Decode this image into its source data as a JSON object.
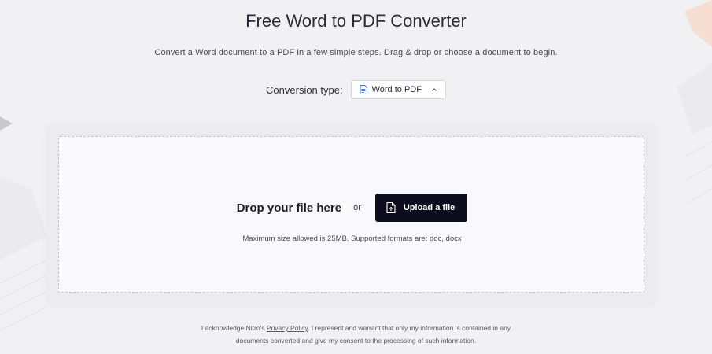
{
  "header": {
    "title": "Free Word to PDF Converter",
    "subtitle": "Convert a Word document to a PDF in a few simple steps. Drag & drop or choose a document to begin."
  },
  "conversion": {
    "label": "Conversion type:",
    "selected": "Word to PDF",
    "icon": "doc-icon",
    "dropdown_icon": "chevron-up-icon"
  },
  "dropzone": {
    "prompt": "Drop your file here",
    "or": "or",
    "upload_label": "Upload a file",
    "upload_icon": "file-upload-icon",
    "limits": "Maximum size allowed is 25MB. Supported formats are: doc, docx"
  },
  "legal": {
    "before_link": "I acknowledge Nitro's ",
    "link": "Privacy Policy",
    "after_link": ". I represent and warrant that only my information is contained in any",
    "line2": "documents converted and give my consent to the processing of such information."
  },
  "colors": {
    "button": "#0c0d1c",
    "dropzone_border": "#c3c0d8",
    "accent_icon": "#3d6fd6"
  }
}
